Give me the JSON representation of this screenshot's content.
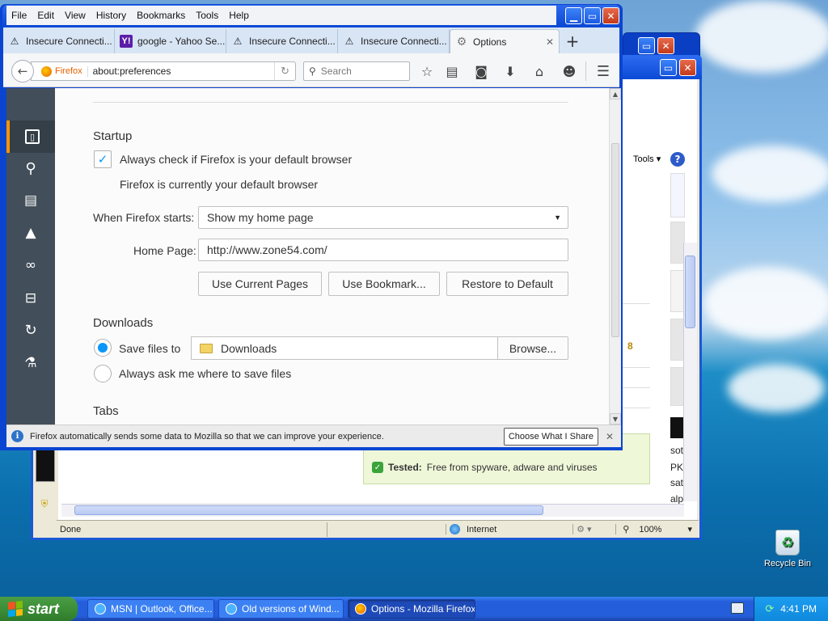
{
  "firefox": {
    "menu": [
      "File",
      "Edit",
      "View",
      "History",
      "Bookmarks",
      "Tools",
      "Help"
    ],
    "tabs": [
      {
        "label": "Insecure Connecti...",
        "icon": "warning-icon"
      },
      {
        "label": "google - Yahoo Se...",
        "icon": "yahoo-icon"
      },
      {
        "label": "Insecure Connecti...",
        "icon": "warning-icon"
      },
      {
        "label": "Insecure Connecti...",
        "icon": "warning-icon"
      },
      {
        "label": "Options",
        "icon": "gear-icon",
        "active": true
      }
    ],
    "new_tab": "+",
    "identity": "Firefox",
    "url": "about:preferences",
    "search_placeholder": "Search",
    "startup": {
      "heading": "Startup",
      "default_check_label": "Always check if Firefox is your default browser",
      "default_check_checked": true,
      "default_status": "Firefox is currently your default browser",
      "when_starts_label": "When Firefox starts:",
      "when_starts_value": "Show my home page",
      "home_page_label": "Home Page:",
      "home_page_value": "http://www.zone54.com/",
      "btn_current": "Use Current Pages",
      "btn_bookmark": "Use Bookmark...",
      "btn_restore": "Restore to Default"
    },
    "downloads": {
      "heading": "Downloads",
      "save_label": "Save files to",
      "folder": "Downloads",
      "browse": "Browse...",
      "ask_label": "Always ask me where to save files",
      "save_selected": true
    },
    "tabs_heading": "Tabs",
    "notification": {
      "text": "Firefox automatically sends some data to Mozilla so that we can improve your experience.",
      "button": "Choose What I Share"
    }
  },
  "ie": {
    "tools": "Tools ▾",
    "tested_bold": "Tested:",
    "tested_text": "Free from spyware, adware and viruses",
    "status_done": "Done",
    "status_zone": "Internet",
    "zoom": "100%",
    "side_fragments": [
      "sot",
      "PK",
      "sat",
      "alp"
    ],
    "number_8": "8"
  },
  "desktop": {
    "recycle_bin": "Recycle Bin"
  },
  "taskbar": {
    "start": "start",
    "items": [
      {
        "label": "MSN | Outlook, Office..."
      },
      {
        "label": "Old versions of Wind..."
      },
      {
        "label": "Options - Mozilla Firefox",
        "active": true
      }
    ],
    "clock": "4:41 PM"
  }
}
